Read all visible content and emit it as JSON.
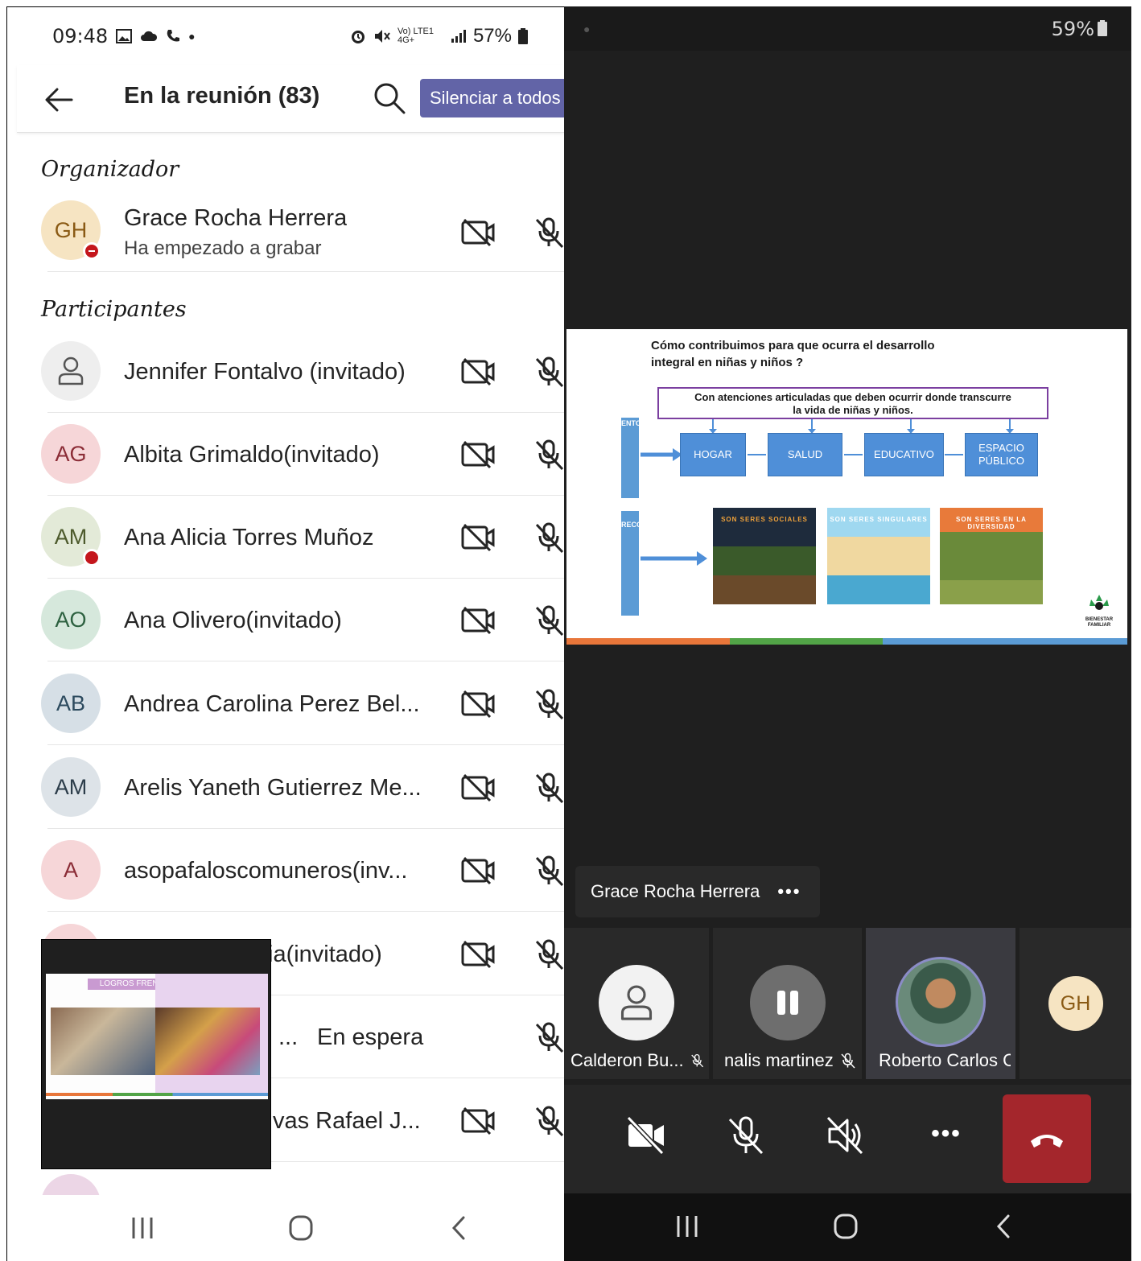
{
  "left_status": {
    "time": "09:48",
    "battery": "57%",
    "network": "Vo) LTE1 4G+"
  },
  "appbar": {
    "title": "En la reunión (83)",
    "mute_all_label": "Silenciar a todos"
  },
  "sections": {
    "organizer_heading": "Organizador",
    "participants_heading": "Participantes"
  },
  "organizer": {
    "initials": "GH",
    "name": "Grace Rocha Herrera",
    "status": "Ha empezado a grabar"
  },
  "participants": [
    {
      "initials": "",
      "name": "Jennifer Fontalvo (invitado)"
    },
    {
      "initials": "AG",
      "name": "Albita Grimaldo(invitado)"
    },
    {
      "initials": "AM",
      "name": "Ana Alicia Torres Muñoz"
    },
    {
      "initials": "AO",
      "name": "Ana Olivero(invitado)"
    },
    {
      "initials": "AB",
      "name": "Andrea Carolina Perez Bel..."
    },
    {
      "initials": "AM",
      "name": "Arelis Yaneth Gutierrez Me..."
    },
    {
      "initials": "A",
      "name": "asopafaloscomuneros(inv..."
    },
    {
      "initials": "",
      "name": "ia(invitado)"
    },
    {
      "initials": "",
      "name": "...",
      "status_label": "En espera"
    },
    {
      "initials": "",
      "name": "vas Rafael J..."
    }
  ],
  "pip": {
    "slide_title": "LOGROS FRENTE AL TEMA PRIORIZADO"
  },
  "right_status": {
    "battery": "59%"
  },
  "slide": {
    "question_line1": "Cómo contribuimos para que ocurra el desarrollo",
    "question_line2": "integral en niñas y niños ?",
    "box_line1": "Con atenciones articuladas que deben ocurrir donde transcurre",
    "box_line2": "la vida de niñas y niños.",
    "entornos": "ENTORNOS",
    "reconocer": "RECONOCER",
    "settings": [
      "HOGAR",
      "SALUD",
      "EDUCATIVO",
      "ESPACIO PÚBLICO"
    ],
    "illustrations": [
      "SON SERES SOCIALES",
      "SON SERES SINGULARES",
      "SON SERES EN LA DIVERSIDAD"
    ],
    "logo_text": "BIENESTAR FAMILIAR"
  },
  "presenter": {
    "name": "Grace Rocha Herrera",
    "more": "•••"
  },
  "video_tiles": [
    {
      "name": "Calderon Bu...",
      "muted": true
    },
    {
      "name": "nalis martinez",
      "muted": true
    },
    {
      "name": "Roberto Carlos C",
      "muted": false
    },
    {
      "name": "",
      "initials": "GH"
    }
  ],
  "controls": {
    "more_label": "•••"
  },
  "colors": {
    "teams_purple": "#6264a7",
    "hangup_red": "#a4262c",
    "dark_bg": "#1f1f1f",
    "recording_red": "#c4161c"
  }
}
